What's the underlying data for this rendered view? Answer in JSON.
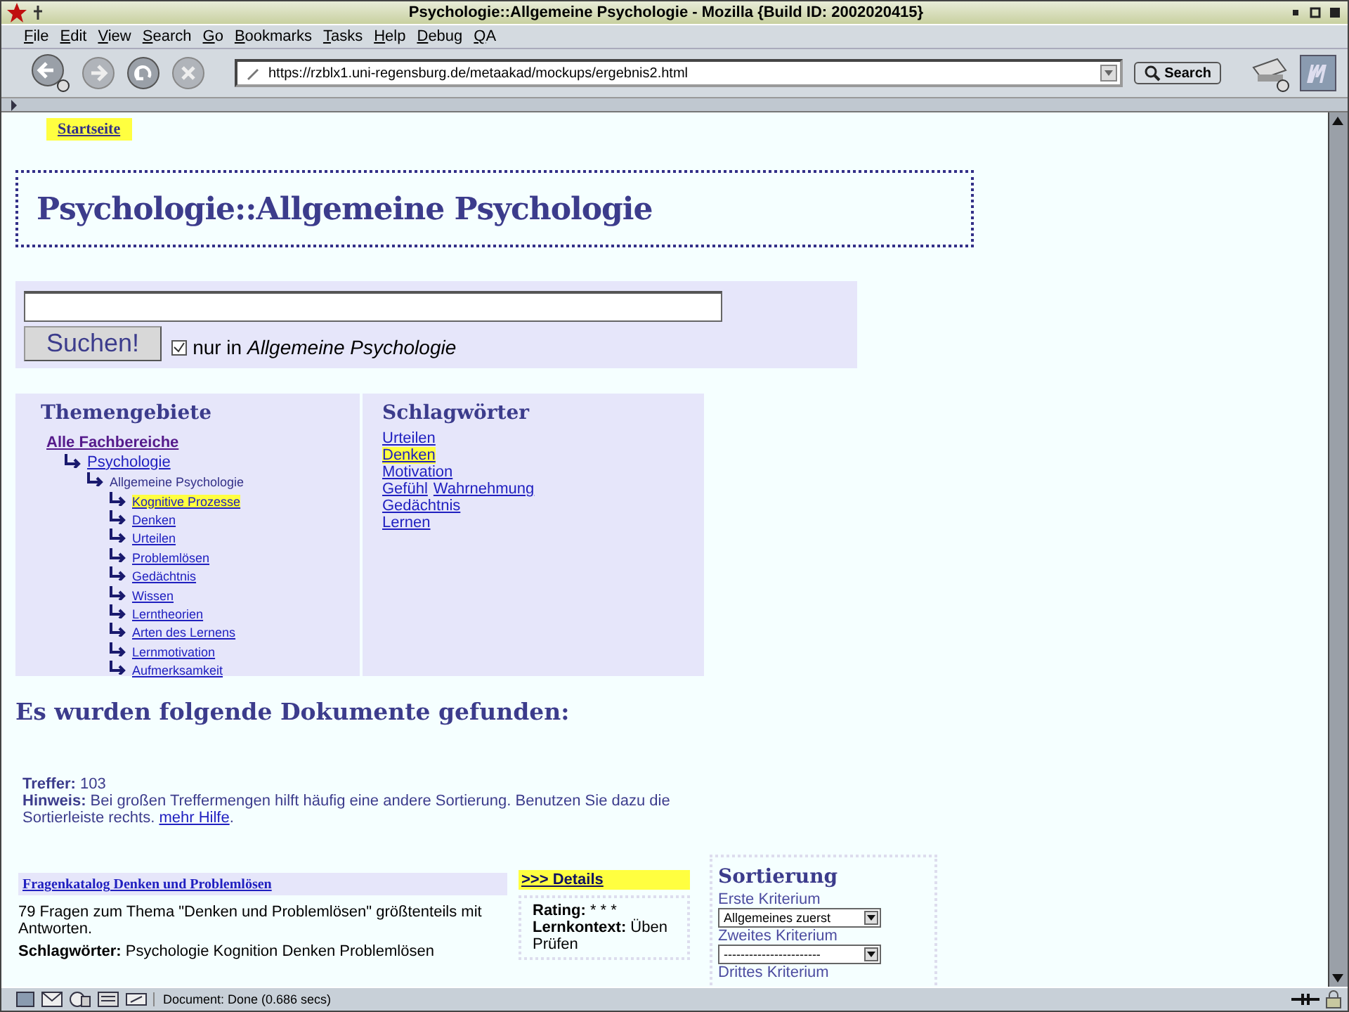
{
  "window": {
    "title": "Psychologie::Allgemeine Psychologie - Mozilla {Build ID: 2002020415}"
  },
  "menu": [
    "File",
    "Edit",
    "View",
    "Search",
    "Go",
    "Bookmarks",
    "Tasks",
    "Help",
    "Debug",
    "QA"
  ],
  "toolbar": {
    "url": "https://rzblx1.uni-regensburg.de/metaakad/mockups/ergebnis2.html",
    "search_button": "Search"
  },
  "page": {
    "home_link": "Startseite",
    "heading": "Psychologie::Allgemeine Psychologie",
    "search": {
      "button": "Suchen!",
      "restrict_checked": true,
      "restrict_label": "nur in *Allgemeine Psychologie*"
    },
    "topics": {
      "title": "Themengebiete",
      "tree": [
        {
          "label": "Alle Fachbereiche",
          "current": false,
          "highlighted": false,
          "children": [
            {
              "label": "Psychologie",
              "current": false,
              "highlighted": false,
              "children": [
                {
                  "label": "Allgemeine Psychologie",
                  "current": true,
                  "highlighted": false,
                  "children": [
                    {
                      "label": "Kognitive Prozesse",
                      "current": false,
                      "highlighted": true
                    },
                    {
                      "label": "Denken",
                      "current": false,
                      "highlighted": false
                    },
                    {
                      "label": "Urteilen",
                      "current": false,
                      "highlighted": false
                    },
                    {
                      "label": "Problemlösen",
                      "current": false,
                      "highlighted": false
                    },
                    {
                      "label": "Gedächtnis",
                      "current": false,
                      "highlighted": false
                    },
                    {
                      "label": "Wissen",
                      "current": false,
                      "highlighted": false
                    },
                    {
                      "label": "Lerntheorien",
                      "current": false,
                      "highlighted": false
                    },
                    {
                      "label": "Arten des Lernens",
                      "current": false,
                      "highlighted": false
                    },
                    {
                      "label": "Lernmotivation",
                      "current": false,
                      "highlighted": false
                    },
                    {
                      "label": "Aufmerksamkeit",
                      "current": false,
                      "highlighted": false
                    }
                  ]
                }
              ]
            }
          ]
        }
      ]
    },
    "keywords": {
      "title": "Schlagwörter",
      "lines": [
        [
          {
            "label": "Urteilen",
            "highlighted": false
          }
        ],
        [
          {
            "label": "Denken",
            "highlighted": true
          }
        ],
        [
          {
            "label": "Motivation",
            "highlighted": false
          }
        ],
        [
          {
            "label": "Gefühl",
            "highlighted": false
          },
          {
            "label": "Wahrnehmung",
            "highlighted": false
          }
        ],
        [
          {
            "label": "Gedächtnis",
            "highlighted": false
          }
        ],
        [
          {
            "label": "Lernen",
            "highlighted": false
          }
        ]
      ]
    },
    "results_heading": "Es wurden folgende Dokumente gefunden:",
    "hits": "**Treffer:** 103",
    "hint": "**Hinweis:** Bei großen Treffermengen hilft häufig eine andere Sortierung. Benutzen Sie dazu die Sortierleiste rechts.",
    "hint_link": "mehr Hilfe",
    "hint_end": ".",
    "results": [
      {
        "title": "Fragenkatalog Denken und Problemlösen",
        "description": "79 Fragen zum Thema \"Denken und Problemlösen\" größtenteils mit Antworten.",
        "keywords": "**Schlagwörter:** Psychologie Kognition Denken Problemlösen",
        "details_link": ">>> Details",
        "rating": "**Rating:**  * * *",
        "context": "**Lernkontext:** Üben Prüfen"
      }
    ],
    "sorting": {
      "title": "Sortierung",
      "criteria": [
        {
          "label": "Erste Kriterium",
          "value": "Allgemeines zuerst"
        },
        {
          "label": "Zweites Kriterium",
          "value": "-----------------------"
        },
        {
          "label": "Drittes Kriterium"
        }
      ]
    }
  },
  "status_bar": {
    "text": "Document: Done (0.686 secs)"
  }
}
